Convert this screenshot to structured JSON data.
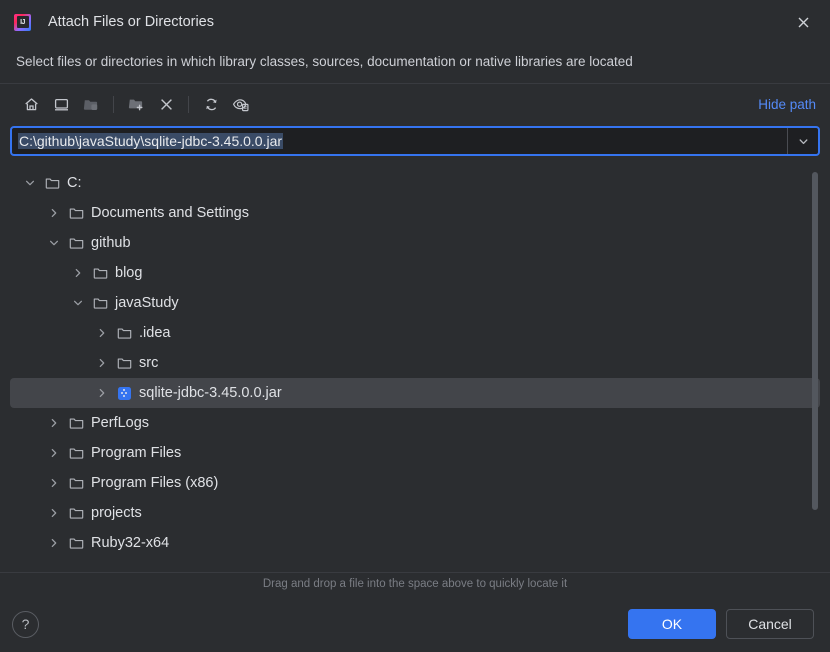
{
  "window": {
    "title": "Attach Files or Directories",
    "app_icon": "intellij-idea-logo",
    "icon_letters": "IJ",
    "close_icon": "close-icon",
    "subtitle": "Select files or directories in which library classes, sources, documentation or native libraries are located"
  },
  "toolbar": {
    "buttons": [
      {
        "name": "home-icon",
        "tooltip": "Home",
        "enabled": true
      },
      {
        "name": "desktop-icon",
        "tooltip": "Desktop",
        "enabled": true
      },
      {
        "name": "project-folder-icon",
        "tooltip": "Project Directory",
        "enabled": false
      },
      {
        "name": "new-folder-icon",
        "tooltip": "New Folder",
        "enabled": true
      },
      {
        "name": "delete-icon",
        "tooltip": "Delete",
        "enabled": true
      },
      {
        "name": "refresh-icon",
        "tooltip": "Refresh",
        "enabled": true
      },
      {
        "name": "show-hidden-files-icon",
        "tooltip": "Show Hidden Files and Directories",
        "enabled": true
      }
    ],
    "hide_path_label": "Hide path"
  },
  "path_field": {
    "value": "C:\\github\\javaStudy\\sqlite-jdbc-3.45.0.0.jar",
    "selected": true,
    "dropdown_icon": "chevron-down-icon",
    "accent_color": "#3574f0",
    "selection_color": "#3a4b66"
  },
  "tree": {
    "rows": [
      {
        "label": "C:",
        "depth": 0,
        "twisty": "expanded",
        "icon": "folder-icon",
        "selected": false
      },
      {
        "label": "Documents and Settings",
        "depth": 1,
        "twisty": "collapsed",
        "icon": "folder-icon",
        "selected": false
      },
      {
        "label": "github",
        "depth": 1,
        "twisty": "expanded",
        "icon": "folder-icon",
        "selected": false
      },
      {
        "label": "blog",
        "depth": 2,
        "twisty": "collapsed",
        "icon": "folder-icon",
        "selected": false
      },
      {
        "label": "javaStudy",
        "depth": 2,
        "twisty": "expanded",
        "icon": "folder-icon",
        "selected": false
      },
      {
        "label": ".idea",
        "depth": 3,
        "twisty": "collapsed",
        "icon": "folder-icon",
        "selected": false
      },
      {
        "label": "src",
        "depth": 3,
        "twisty": "collapsed",
        "icon": "folder-icon",
        "selected": false
      },
      {
        "label": "sqlite-jdbc-3.45.0.0.jar",
        "depth": 3,
        "twisty": "collapsed",
        "icon": "jar-icon",
        "selected": true
      },
      {
        "label": "PerfLogs",
        "depth": 1,
        "twisty": "collapsed",
        "icon": "folder-icon",
        "selected": false
      },
      {
        "label": "Program Files",
        "depth": 1,
        "twisty": "collapsed",
        "icon": "folder-icon",
        "selected": false
      },
      {
        "label": "Program Files (x86)",
        "depth": 1,
        "twisty": "collapsed",
        "icon": "folder-icon",
        "selected": false
      },
      {
        "label": "projects",
        "depth": 1,
        "twisty": "collapsed",
        "icon": "folder-icon",
        "selected": false
      },
      {
        "label": "Ruby32-x64",
        "depth": 1,
        "twisty": "collapsed",
        "icon": "folder-icon",
        "selected": false
      }
    ],
    "selection_color": "#43454a"
  },
  "footer": {
    "hint": "Drag and drop a file into the space above to quickly locate it",
    "help_label": "?",
    "ok_label": "OK",
    "cancel_label": "Cancel",
    "ok_color": "#3574f0"
  }
}
